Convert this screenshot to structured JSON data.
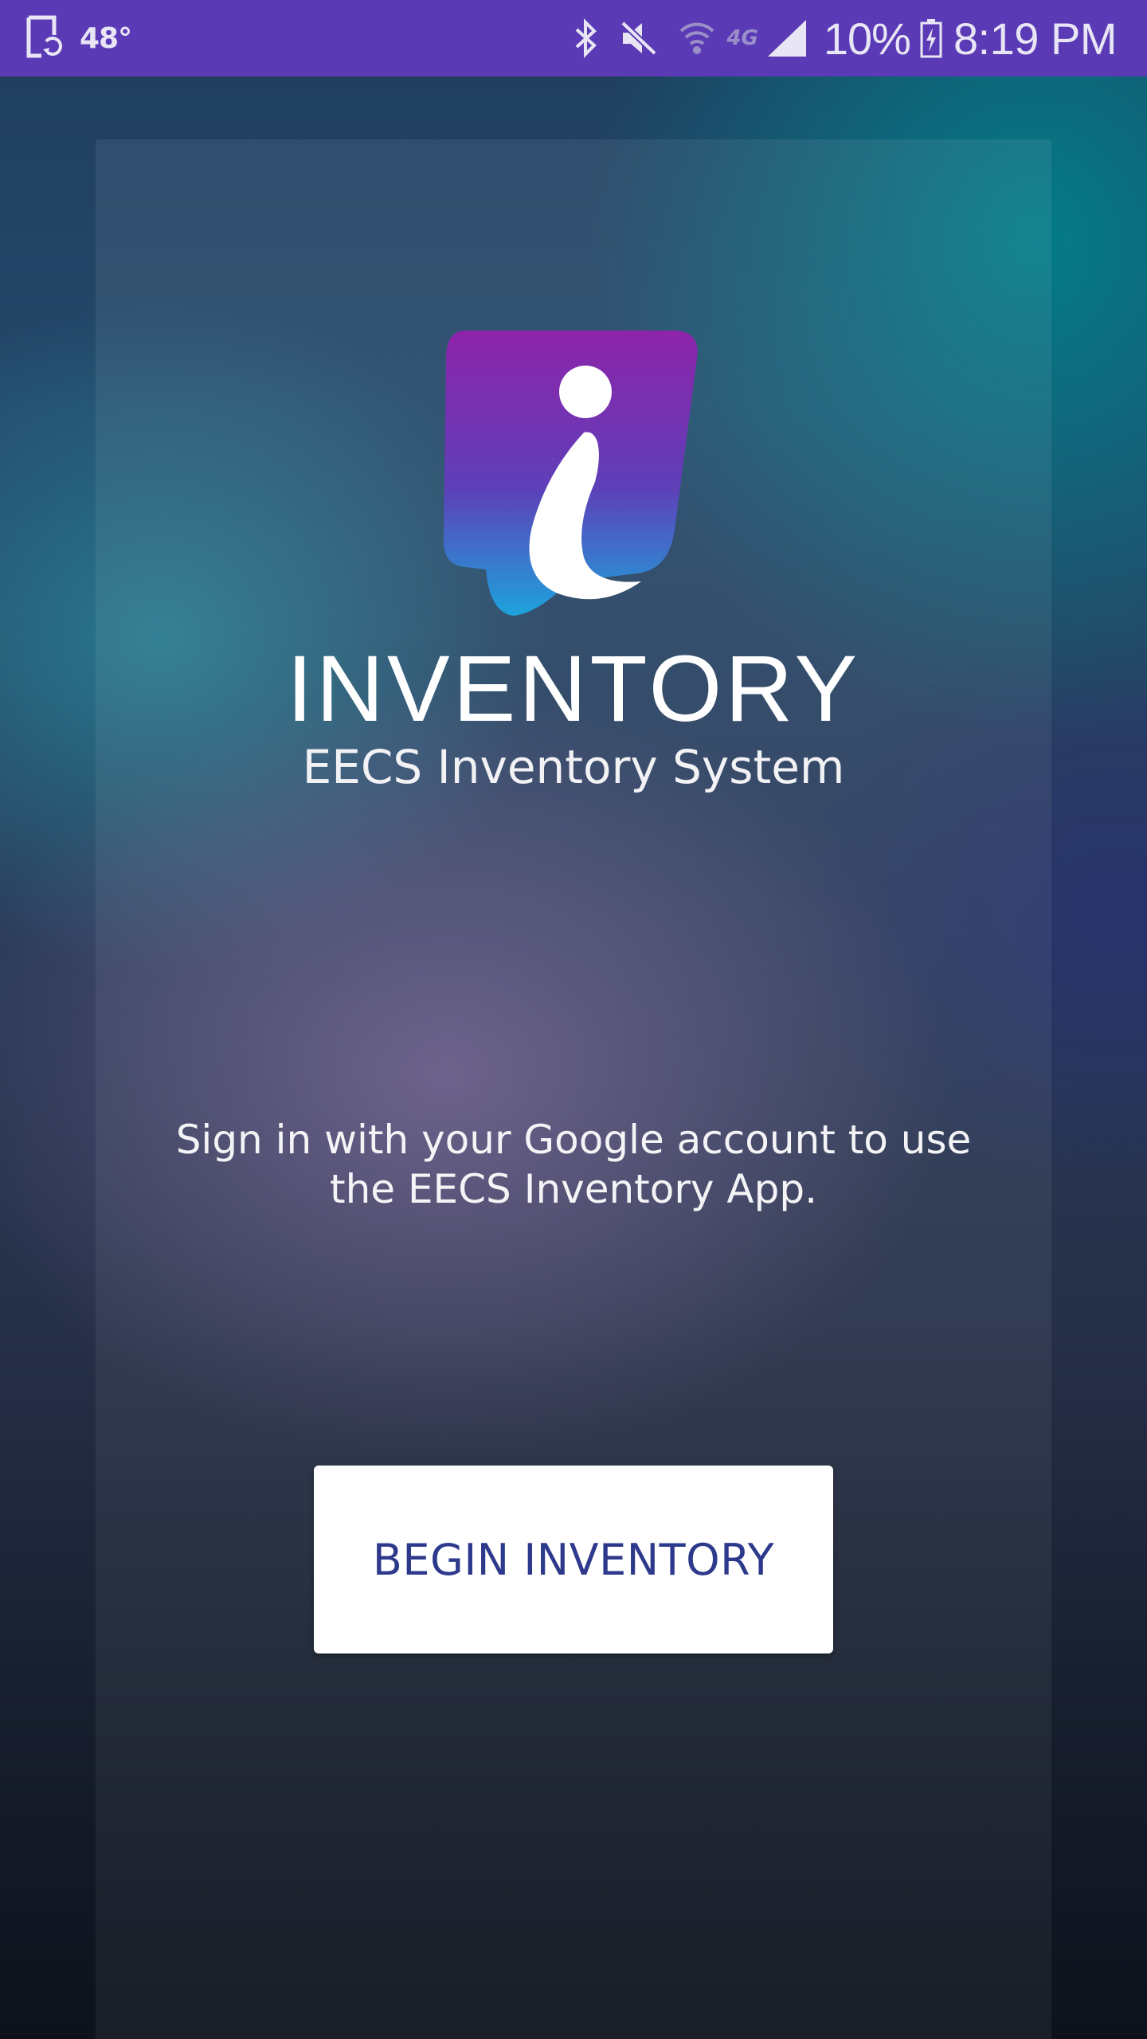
{
  "status_bar": {
    "temperature": "48°",
    "network": "4G",
    "battery_percent": "10%",
    "time": "8:19 PM",
    "icons": [
      "screen-rotation-icon",
      "bluetooth-icon",
      "mute-icon",
      "wifi-icon",
      "network-4g-icon",
      "signal-bars-icon",
      "battery-charging-icon"
    ],
    "background_color": "#5b3bb5"
  },
  "app": {
    "logo_icon": "inventory-i-logo-icon",
    "title": "INVENTORY",
    "subtitle": "EECS Inventory System"
  },
  "signin": {
    "message": "Sign in with your Google account to use the EECS Inventory App."
  },
  "actions": {
    "begin_label": "BEGIN INVENTORY",
    "begin_text_color": "#2d3a8c"
  }
}
